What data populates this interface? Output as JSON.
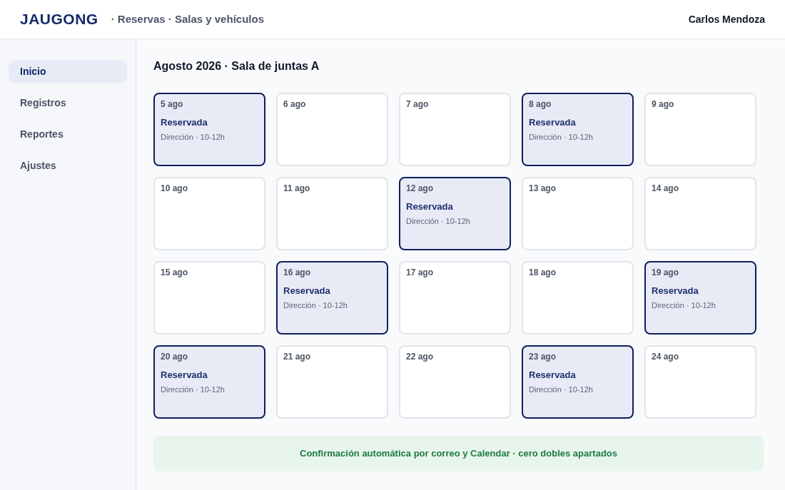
{
  "header": {
    "logo": "JAUGONG",
    "subtitle": "· Reservas · Salas y vehículos",
    "user": "Carlos Mendoza"
  },
  "sidebar": {
    "items": [
      {
        "label": "Inicio",
        "selected": true
      },
      {
        "label": "Registros",
        "selected": false
      },
      {
        "label": "Reportes",
        "selected": false
      },
      {
        "label": "Ajustes",
        "selected": false
      }
    ]
  },
  "calendar": {
    "title": "Agosto 2026 · Sala de juntas A",
    "days": [
      {
        "date": "5 ago",
        "reserved": true,
        "status": "Reservada",
        "detail": "Dirección · 10-12h"
      },
      {
        "date": "6 ago",
        "reserved": false
      },
      {
        "date": "7 ago",
        "reserved": false
      },
      {
        "date": "8 ago",
        "reserved": true,
        "status": "Reservada",
        "detail": "Dirección · 10-12h"
      },
      {
        "date": "9 ago",
        "reserved": false
      },
      {
        "date": "10 ago",
        "reserved": false
      },
      {
        "date": "11 ago",
        "reserved": false
      },
      {
        "date": "12 ago",
        "reserved": true,
        "status": "Reservada",
        "detail": "Dirección · 10-12h"
      },
      {
        "date": "13 ago",
        "reserved": false
      },
      {
        "date": "14 ago",
        "reserved": false
      },
      {
        "date": "15 ago",
        "reserved": false
      },
      {
        "date": "16 ago",
        "reserved": true,
        "status": "Reservada",
        "detail": "Dirección · 10-12h"
      },
      {
        "date": "17 ago",
        "reserved": false
      },
      {
        "date": "18 ago",
        "reserved": false
      },
      {
        "date": "19 ago",
        "reserved": true,
        "status": "Reservada",
        "detail": "Dirección · 10-12h"
      },
      {
        "date": "20 ago",
        "reserved": true,
        "status": "Reservada",
        "detail": "Dirección · 10-12h"
      },
      {
        "date": "21 ago",
        "reserved": false
      },
      {
        "date": "22 ago",
        "reserved": false
      },
      {
        "date": "23 ago",
        "reserved": true,
        "status": "Reservada",
        "detail": "Dirección · 10-12h"
      },
      {
        "date": "24 ago",
        "reserved": false
      }
    ]
  },
  "banner": "Confirmación automática por correo y Calendar · cero dobles apartados"
}
